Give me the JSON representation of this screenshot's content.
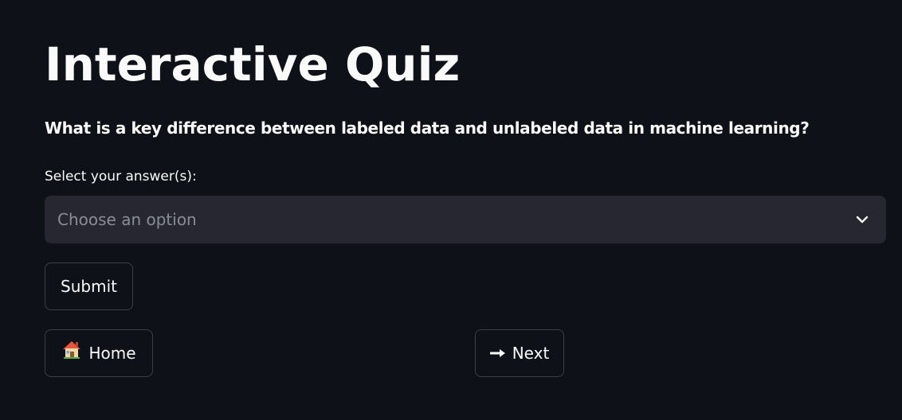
{
  "page": {
    "title": "Interactive Quiz",
    "question": "What is a key difference between labeled data and unlabeled data in machine learning?"
  },
  "answer_select": {
    "label": "Select your answer(s):",
    "placeholder": "Choose an option",
    "icon": "chevron-down-icon"
  },
  "buttons": {
    "submit_label": "Submit",
    "home_label": "Home",
    "home_icon": "house-icon",
    "next_label": "Next",
    "next_icon": "arrow-right-icon"
  },
  "colors": {
    "background": "#0e1117",
    "text": "#fafafa",
    "select_background": "#262730",
    "placeholder": "#8b8d96",
    "button_border": "#3d3f4a"
  }
}
